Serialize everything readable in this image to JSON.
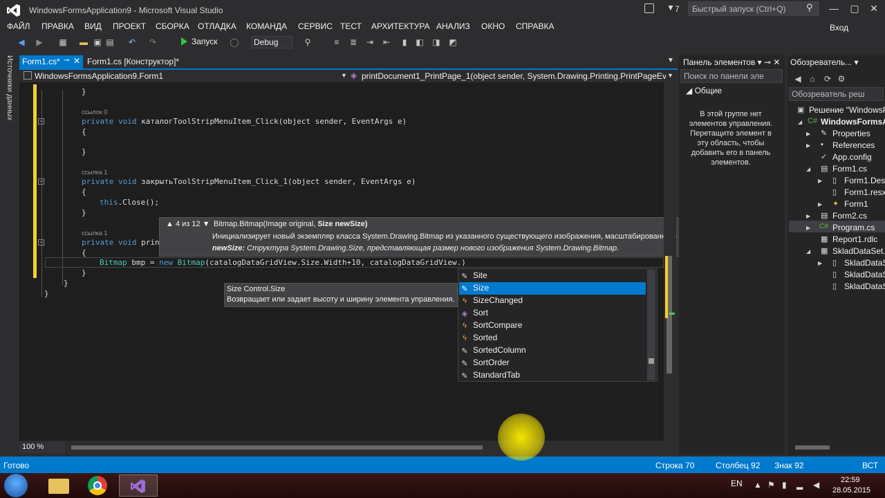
{
  "window": {
    "title": "WindowsFormsApplication9 - Microsoft Visual Studio",
    "notification_count": "7",
    "quick_launch_placeholder": "Быстрый запуск (Ctrl+Q)",
    "sign_in": "Вход"
  },
  "menu": {
    "items": [
      "ФАЙЛ",
      "ПРАВКА",
      "ВИД",
      "ПРОЕКТ",
      "СБОРКА",
      "ОТЛАДКА",
      "КОМАНДА",
      "СЕРВИС",
      "ТЕСТ",
      "АРХИТЕКТУРА",
      "АНАЛИЗ",
      "ОКНО",
      "СПРАВКА"
    ]
  },
  "toolbar": {
    "run_label": "Запуск",
    "config": "Debug"
  },
  "left_strip": {
    "label": "Источники данных"
  },
  "tabs": {
    "active": "Form1.cs*",
    "other": "Form1.cs [Конструктор]*"
  },
  "navbar": {
    "left": "WindowsFormsApplication9.Form1",
    "right": "printDocument1_PrintPage_1(object sender, System.Drawing.Printing.PrintPageEventArgs e)"
  },
  "code": {
    "refs": [
      "ссылок 0",
      "ссылка 1",
      "ссылка 1"
    ],
    "method1": "каталогToolStripMenuItem_Click",
    "method2": "закрытьToolStripMenuItem_Click_1",
    "method3_partial": "prin",
    "params": "(object sender, EventArgs e)",
    "close_stmt": "Close();",
    "bitmap_var": "bmp",
    "bitmap_tail": "(catalogDataGridView.Size.Width+10, catalogDataGridView.)"
  },
  "param_info": {
    "counter": "4 из 12",
    "signature_plain": "Bitmap.Bitmap(Image original, ",
    "signature_bold": "Size newSize)",
    "description": "Инициализирует новый экземпляр класса System.Drawing.Bitmap из указанного существующего изображения, масштабированного до заданного размера.",
    "param_name": "newSize:",
    "param_desc": " Структура System.Drawing.Size, представляющая размер нового изображения System.Drawing.Bitmap."
  },
  "member_tip": {
    "title": "Size Control.Size",
    "description": "Возвращает или задает высоту и ширину элемента управления."
  },
  "completion": {
    "items": [
      {
        "label": "Site",
        "kind": "property"
      },
      {
        "label": "Size",
        "kind": "property",
        "selected": true
      },
      {
        "label": "SizeChanged",
        "kind": "event"
      },
      {
        "label": "Sort",
        "kind": "method"
      },
      {
        "label": "SortCompare",
        "kind": "event"
      },
      {
        "label": "Sorted",
        "kind": "event"
      },
      {
        "label": "SortedColumn",
        "kind": "property"
      },
      {
        "label": "SortOrder",
        "kind": "property"
      },
      {
        "label": "StandardTab",
        "kind": "property"
      }
    ]
  },
  "editor": {
    "zoom": "100 %"
  },
  "toolbox": {
    "title": "Панель элементов",
    "search_placeholder": "Поиск по панели эле",
    "group": "Общие",
    "empty_message": "В этой группе нет элементов управления. Перетащите элемент в эту область, чтобы добавить его в панель элементов."
  },
  "solution_explorer": {
    "title": "Обозреватель...",
    "search_placeholder": "Обозреватель реш",
    "items": [
      "Решение \"WindowsF",
      "WindowsFormsA",
      "Properties",
      "References",
      "App.config",
      "Form1.cs",
      "Form1.Des",
      "Form1.resx",
      "Form1",
      "Form2.cs",
      "Program.cs",
      "Report1.rdlc",
      "SkladDataSet.x",
      "SkladDataS",
      "SkladDataS",
      "SkladDataS"
    ]
  },
  "status": {
    "ready": "Готово",
    "row": "Строка 70",
    "col": "Столбец 92",
    "char": "Знак 92",
    "mode": "ВСТ"
  },
  "taskbar": {
    "lang": "EN",
    "time": "22:59",
    "date": "28.05.2015"
  },
  "colors": {
    "accent": "#007acc",
    "keyword": "#569cd6",
    "type": "#4ec9b0",
    "margin_change": "#f5d027"
  }
}
